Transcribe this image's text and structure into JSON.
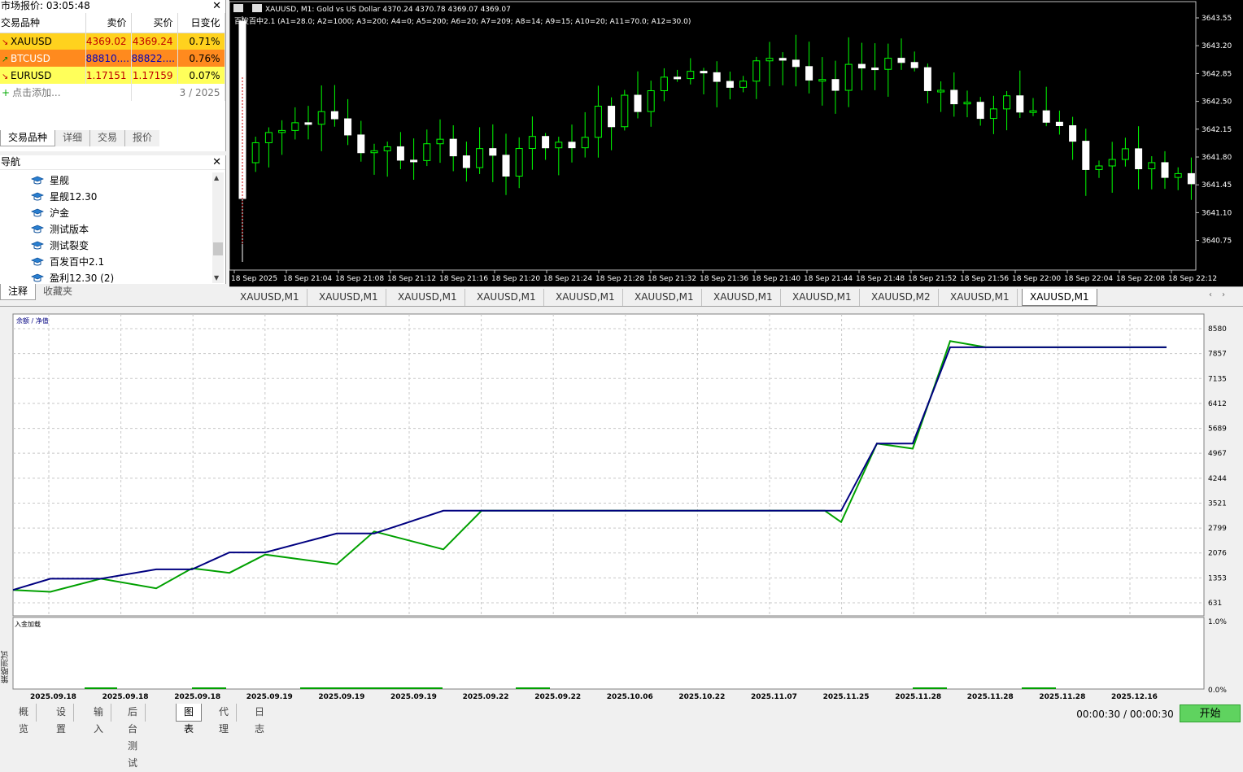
{
  "market_watch": {
    "title": "市场报价: 03:05:48",
    "headers": [
      "交易品种",
      "卖价",
      "买价",
      "日变化"
    ],
    "rows": [
      {
        "symbol": "XAUUSD",
        "arrow": "↘",
        "bid": "4369.02",
        "ask": "4369.24",
        "change": "0.71%",
        "color": "#ffd21e"
      },
      {
        "symbol": "BTCUSD",
        "arrow": "↗",
        "bid": "88810....",
        "ask": "88822....",
        "change": "0.76%",
        "color": "#ff8a1e"
      },
      {
        "symbol": "EURUSD",
        "arrow": "↘",
        "bid": "1.17151",
        "ask": "1.17159",
        "change": "0.07%",
        "color": "#ffff5a"
      }
    ],
    "add_label": "点击添加...",
    "count": "3 / 2025",
    "tabs": [
      "交易品种",
      "详细",
      "交易",
      "报价"
    ]
  },
  "navigator": {
    "title": "导航",
    "items": [
      "星舰",
      "星舰12.30",
      "沪金",
      "测试版本",
      "测试裂变",
      "百发百中2.1",
      "盈利12.30 (2)"
    ],
    "tabs": [
      "注释",
      "收藏夹"
    ]
  },
  "price_chart": {
    "header": "XAUUSD, M1:  Gold vs US Dollar  4370.24 4370.78 4369.07 4369.07",
    "indicator": "百发百中2.1 (A1=28.0; A2=1000; A3=200; A4=0; A5=200; A6=20; A7=209; A8=14; A9=15; A10=20; A11=70.0; A12=30.0)",
    "y_ticks": [
      "3643.55",
      "3643.20",
      "3642.85",
      "3642.50",
      "3642.15",
      "3641.80",
      "3641.45",
      "3641.10",
      "3640.75"
    ],
    "x_ticks": [
      "18 Sep 2025",
      "18 Sep 21:04",
      "18 Sep 21:08",
      "18 Sep 21:12",
      "18 Sep 21:16",
      "18 Sep 21:20",
      "18 Sep 21:24",
      "18 Sep 21:28",
      "18 Sep 21:32",
      "18 Sep 21:36",
      "18 Sep 21:40",
      "18 Sep 21:44",
      "18 Sep 21:48",
      "18 Sep 21:52",
      "18 Sep 21:56",
      "18 Sep 22:00",
      "18 Sep 22:04",
      "18 Sep 22:08",
      "18 Sep 22:12"
    ],
    "colors": {
      "bull": "#00ff00",
      "bear": "#ffffff",
      "bg": "#000000"
    }
  },
  "chart_tabs": [
    "XAUUSD,M1",
    "XAUUSD,M1",
    "XAUUSD,M1",
    "XAUUSD,M1",
    "XAUUSD,M1",
    "XAUUSD,M1",
    "XAUUSD,M1",
    "XAUUSD,M1",
    "XAUUSD,M2",
    "XAUUSD,M1",
    "XAUUSD,M1"
  ],
  "chart_data": [
    {
      "type": "line",
      "title": "余额 / 净值",
      "series": [
        {
          "name": "余额",
          "color": "#000080",
          "values": [
            1003,
            1330,
            1330,
            1600,
            1600,
            2090,
            2090,
            2640,
            2640,
            3300,
            3300,
            3300,
            3300,
            3300,
            3300,
            3300,
            5250,
            5250,
            8040,
            8040,
            8040,
            8040,
            8040
          ]
        },
        {
          "name": "净值",
          "color": "#00a000",
          "values": [
            1003,
            950,
            1330,
            1050,
            1630,
            1500,
            2030,
            1750,
            2700,
            2180,
            3300,
            3300,
            3300,
            3300,
            3300,
            2970,
            5250,
            5100,
            8220,
            8040,
            8040,
            8040,
            8040
          ]
        }
      ],
      "y_ticks": [
        "8580",
        "7857",
        "7135",
        "6412",
        "5689",
        "4967",
        "4244",
        "3521",
        "2799",
        "2076",
        "1353",
        "631"
      ],
      "ylim": [
        631,
        8580
      ]
    },
    {
      "type": "bar",
      "title": "入金加载",
      "y_ticks": [
        "1.0%",
        "0.0%"
      ],
      "x_ticks": [
        "2025.09.18",
        "2025.09.18",
        "2025.09.18",
        "2025.09.19",
        "2025.09.19",
        "2025.09.19",
        "2025.09.22",
        "2025.09.22",
        "2025.10.06",
        "2025.10.22",
        "2025.11.07",
        "2025.11.25",
        "2025.11.28",
        "2025.11.28",
        "2025.11.28",
        "2025.12.16"
      ]
    }
  ],
  "tester": {
    "side_label": "策略测试",
    "tabs": [
      "概览",
      "设置",
      "输入",
      "后台测试",
      "图表",
      "代理",
      "日志"
    ],
    "timer": "00:00:30 / 00:00:30",
    "start_label": "开始"
  }
}
